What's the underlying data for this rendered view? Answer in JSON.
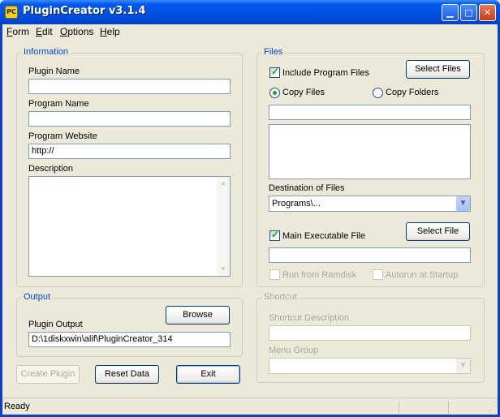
{
  "window": {
    "title": "PluginCreator v3.1.4",
    "icon_text": "PC"
  },
  "menu": [
    "Form",
    "Edit",
    "Options",
    "Help"
  ],
  "information": {
    "legend": "Information",
    "plugin_name_label": "Plugin Name",
    "plugin_name_value": "",
    "program_name_label": "Program Name",
    "program_name_value": "",
    "program_website_label": "Program Website",
    "program_website_value": "http://",
    "description_label": "Description",
    "description_value": ""
  },
  "output": {
    "legend": "Output",
    "browse_label": "Browse",
    "plugin_output_label": "Plugin Output",
    "plugin_output_value": "D:\\1diskxwin\\alif\\PluginCreator_314"
  },
  "actions": {
    "create_plugin": "Create Plugin",
    "reset_data": "Reset Data",
    "exit": "Exit"
  },
  "files": {
    "legend": "Files",
    "include_program_files": {
      "label": "Include Program Files",
      "checked": true
    },
    "select_files_label": "Select Files",
    "copy_files": {
      "label": "Copy Files",
      "selected": true
    },
    "copy_folders": {
      "label": "Copy Folders",
      "selected": false
    },
    "path_value": "",
    "destination_label": "Destination of Files",
    "destination_value": "Programs\\...",
    "main_executable": {
      "label": "Main Executable File",
      "checked": true
    },
    "select_file_label": "Select File",
    "main_executable_value": "",
    "run_from_ramdisk": {
      "label": "Run from Ramdisk",
      "checked": false,
      "enabled": false
    },
    "autorun_at_startup": {
      "label": "Autorun at Startup",
      "checked": false,
      "enabled": false
    }
  },
  "shortcut": {
    "legend": "Shortcut",
    "description_label": "Shortcut Description",
    "description_value": "",
    "menu_group_label": "Menu Group",
    "menu_group_value": ""
  },
  "status": {
    "text": "Ready"
  }
}
